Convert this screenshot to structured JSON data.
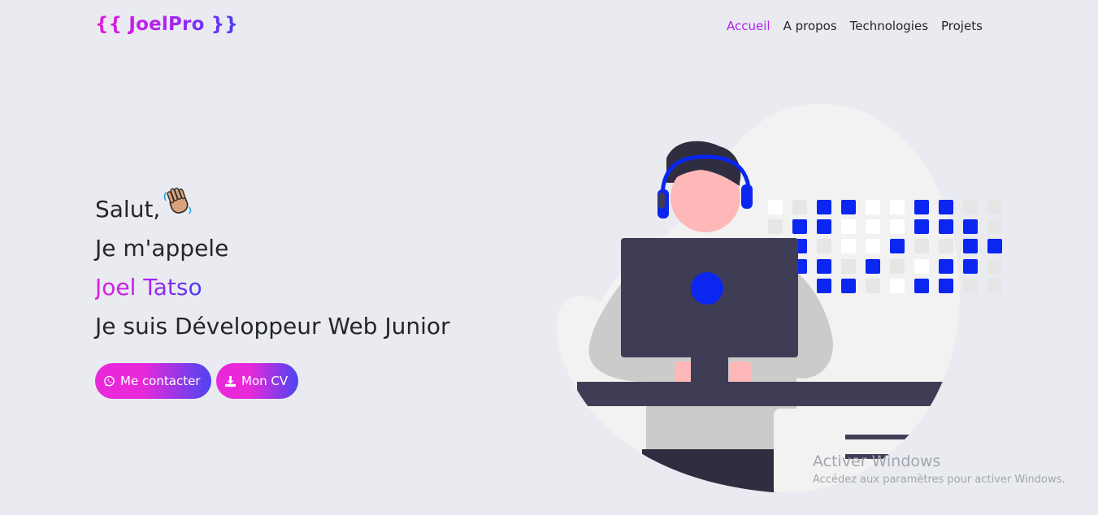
{
  "brand": {
    "logo_text": "{{ JoelPro }}"
  },
  "nav": {
    "items": [
      {
        "label": "Accueil",
        "active": true
      },
      {
        "label": "A propos",
        "active": false
      },
      {
        "label": "Technologies",
        "active": false
      },
      {
        "label": "Projets",
        "active": false
      }
    ]
  },
  "hero": {
    "greeting": "Salut,",
    "intro": "Je m'appele",
    "name": "Joel Tatso",
    "role": "Je suis Développeur Web Junior"
  },
  "buttons": {
    "contact_label": "Me contacter",
    "cv_label": "Mon CV"
  },
  "icons": {
    "wave": "waving-hand-icon",
    "whatsapp": "whatsapp-icon",
    "download": "download-icon"
  },
  "colors": {
    "accent": "#b421ee",
    "gradient_start": "#e929d9",
    "gradient_end": "#4d44f0",
    "illustration_blue": "#0a26f0",
    "monitor": "#3f3d56"
  },
  "watermark": {
    "title": "Activer Windows",
    "subtitle": "Accédez aux paramètres pour activer Windows."
  }
}
